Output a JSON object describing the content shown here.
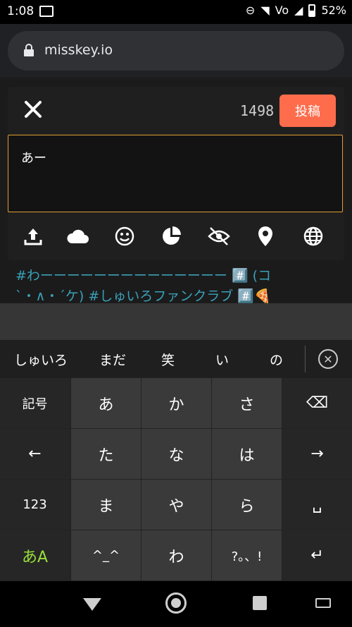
{
  "status": {
    "time": "1:08",
    "battery": "52%",
    "network": "Vo"
  },
  "browser": {
    "url": "misskey.io"
  },
  "timeline": {
    "line1": "#わーーーーーーーーーーーーーー #️⃣ (コ",
    "line2": "`・∧・´ケ) #しゅいろファンクラブ #️⃣🍕"
  },
  "composer": {
    "counter": "1498",
    "post_label": "投稿",
    "text": "あー"
  },
  "suggestions": [
    "しゅいろ",
    "まだ",
    "笑",
    "い",
    "の"
  ],
  "keys": {
    "r1": [
      "記号",
      "あ",
      "か",
      "さ",
      "⌫"
    ],
    "r2": [
      "←",
      "た",
      "な",
      "は",
      "→"
    ],
    "r3": [
      "123",
      "ま",
      "や",
      "ら",
      "␣"
    ],
    "r4": [
      "あA",
      "^_^",
      "わ",
      "?。、!",
      "↵"
    ]
  },
  "colors": {
    "accent": "#fe6c4c",
    "border": "#e0a030",
    "link": "#3aa0b8"
  }
}
